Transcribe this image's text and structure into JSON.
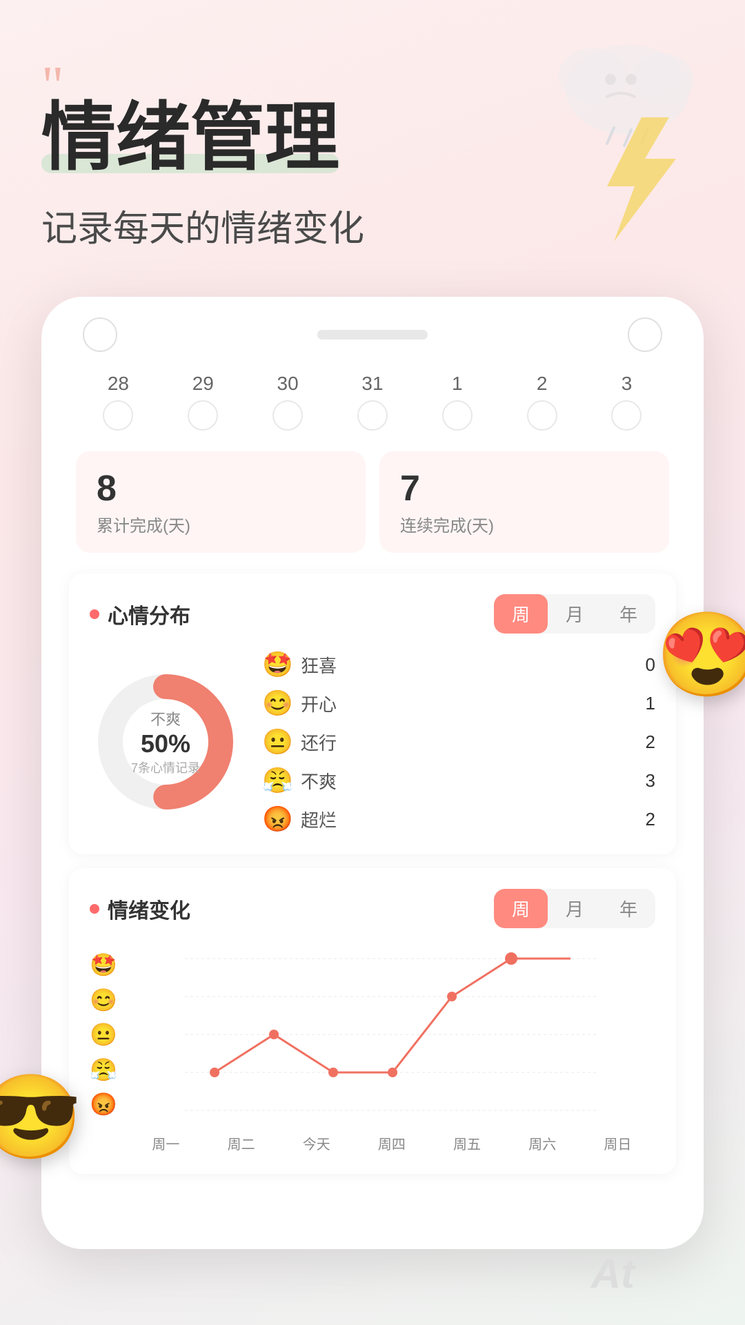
{
  "header": {
    "quote_icon": "““",
    "main_title": "情绪管理",
    "subtitle": "记录每天的情绪变化"
  },
  "calendar": {
    "days": [
      "28",
      "29",
      "30",
      "31",
      "1",
      "2",
      "3"
    ]
  },
  "stats": {
    "card1_number": "8",
    "card1_label": "累计完成(天)",
    "card2_number": "7",
    "card2_label": "连续完成(天)"
  },
  "mood_distribution": {
    "section_title": "心情分布",
    "tabs": [
      "周",
      "月",
      "年"
    ],
    "active_tab": "周",
    "donut_label": "不爽",
    "donut_percent": "50%",
    "donut_sub": "7条心情记录",
    "moods": [
      {
        "emoji": "😆",
        "name": "狂喜",
        "count": "0"
      },
      {
        "emoji": "😊",
        "name": "开心",
        "count": "1"
      },
      {
        "emoji": "😐",
        "name": "还行",
        "count": "2"
      },
      {
        "emoji": "😤",
        "name": "不爽",
        "count": "3"
      },
      {
        "emoji": "😡",
        "name": "超烂",
        "count": "2"
      }
    ]
  },
  "emotion_change": {
    "section_title": "情绪变化",
    "tabs": [
      "周",
      "月",
      "年"
    ],
    "active_tab": "周",
    "y_emojis": [
      "😆",
      "😊",
      "😐",
      "😤",
      "😡"
    ],
    "x_labels": [
      "周一",
      "周二",
      "今天",
      "周四",
      "周五",
      "周六",
      "周日"
    ],
    "line_color": "#ff6b6b"
  },
  "decorations": {
    "at_text": "At"
  }
}
